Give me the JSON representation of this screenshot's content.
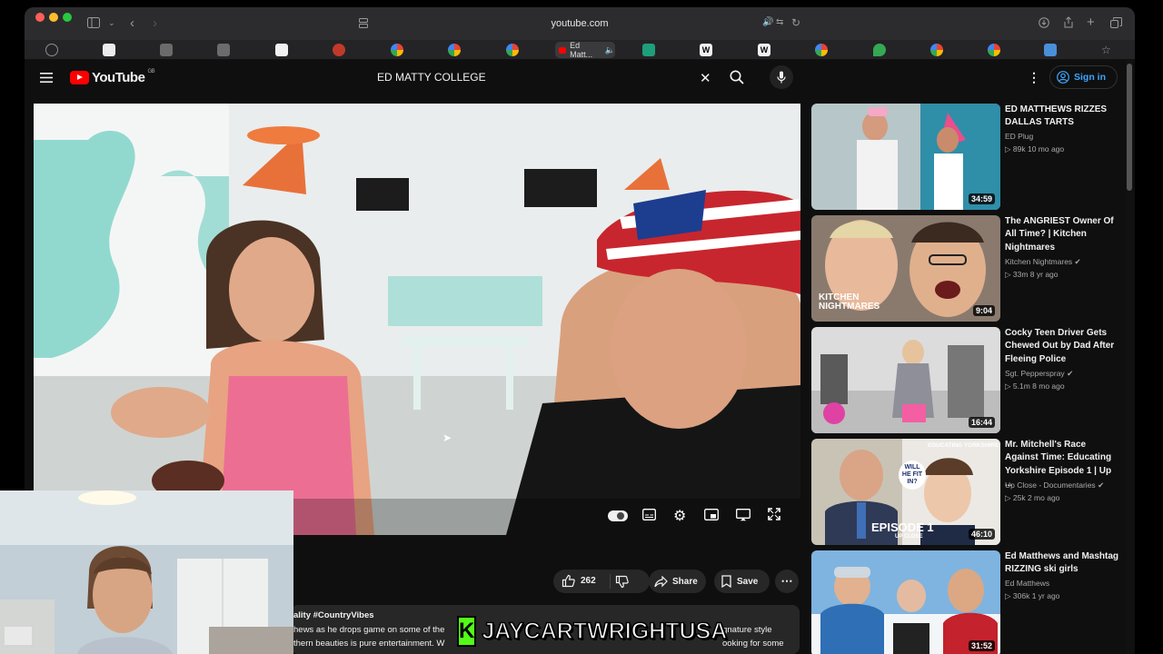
{
  "browser": {
    "url": "youtube.com",
    "active_tab_label": "Ed Matt..."
  },
  "youtube": {
    "logo_text": "YouTube",
    "logo_region": "GB",
    "search_value": "ED MATTY COLLEGE",
    "sign_in_label": "Sign in"
  },
  "video": {
    "like_count": "262",
    "share_label": "Share",
    "save_label": "Save",
    "desc_line1": "ality #CountryVibes",
    "desc_line2a": "hews as he drops game on some of the",
    "desc_line2b": "ignature style",
    "desc_line3a": "thern beauties is pure entertainment. W",
    "desc_line3b": "ooking for some"
  },
  "overlay": {
    "kick_letter": "K",
    "streamer_name": "JAYCARTWRIGHTUSA"
  },
  "recommendations": [
    {
      "title": "ED MATTHEWS RIZZES DALLAS TARTS",
      "channel": "ED Plug",
      "verified": false,
      "meta": "▷ 89k  10 mo ago",
      "duration": "34:59"
    },
    {
      "title": "The ANGRIEST Owner Of All Time? | Kitchen Nightmares",
      "channel": "Kitchen Nightmares",
      "verified": true,
      "meta": "▷ 33m  8 yr ago",
      "duration": "9:04",
      "thumb_text": "KITCHEN NIGHTMARES"
    },
    {
      "title": "Cocky Teen Driver Gets Chewed Out by Dad After Fleeing Police",
      "channel": "Sgt. Pepperspray",
      "verified": true,
      "meta": "▷ 5.1m  8 mo ago",
      "duration": "16:44"
    },
    {
      "title": "Mr. Mitchell's Race Against Time: Educating Yorkshire Episode 1 | Up ...",
      "channel": "Up Close - Documentaries",
      "verified": true,
      "meta": "▷ 25k  2 mo ago",
      "duration": "46:10",
      "thumb_text": "EPISODE 1",
      "thumb_sub": "UP CLOSE",
      "thumb_top": "EDUCATING YORKSHIRE",
      "thumb_bubble": "WILL HE FIT IN?"
    },
    {
      "title": "Ed Matthews and Mashtag RIZZING ski girls",
      "channel": "Ed Matthews",
      "verified": false,
      "meta": "▷ 306k  1 yr ago",
      "duration": "31:52"
    }
  ],
  "colors": {
    "yt_bg": "#0f0f0f",
    "brand_red": "#ff0000",
    "kick_green": "#53fc18",
    "sign_in_blue": "#3ea6ff"
  }
}
